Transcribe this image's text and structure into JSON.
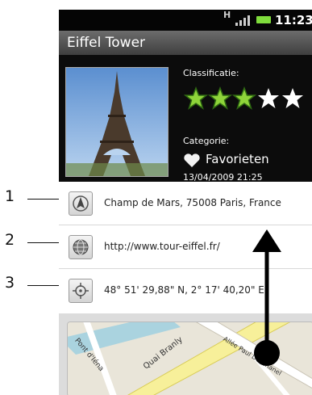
{
  "status_bar": {
    "time": "11:23",
    "network_label": "H"
  },
  "title_bar": {
    "title": "Eiffel Tower"
  },
  "details": {
    "classification_label": "Classificatie:",
    "rating_filled": 3,
    "rating_total": 5,
    "category_label": "Categorie:",
    "category_value": "Favorieten",
    "timestamp": "13/04/2009 21:25"
  },
  "info_rows": [
    {
      "icon": "navigate-icon",
      "text": "Champ de Mars, 75008 Paris, France"
    },
    {
      "icon": "globe-icon",
      "text": "http://www.tour-eiffel.fr/"
    },
    {
      "icon": "crosshair-icon",
      "text": "48° 51' 29,88\" N, 2° 17' 40,20\" E"
    }
  ],
  "callouts": [
    "1",
    "2",
    "3"
  ],
  "map": {
    "streets": [
      "Pont d'Iéna",
      "Quai Branly",
      "Allée Paul Deschanel"
    ]
  },
  "colors": {
    "star_green": "#8fd43a",
    "battery_green": "#7fdc3c"
  }
}
